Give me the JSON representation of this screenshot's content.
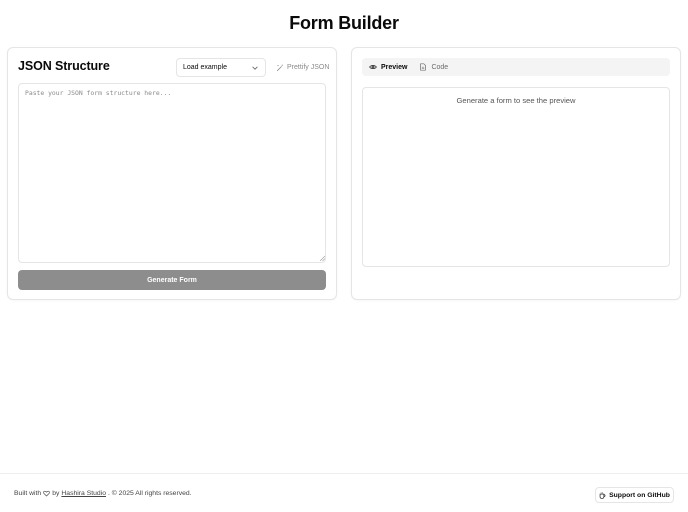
{
  "page": {
    "title": "Form Builder"
  },
  "editor": {
    "title": "JSON Structure",
    "example_select": {
      "value": "Load example",
      "icon": "chevron-down-icon"
    },
    "prettify_label": "Prettify JSON",
    "prettify_icon": "wand-icon",
    "textarea": {
      "value": "",
      "placeholder": "Paste your JSON form structure here..."
    },
    "generate_label": "Generate Form"
  },
  "preview": {
    "tabs": [
      {
        "label": "Preview",
        "icon": "eye-icon",
        "active": true
      },
      {
        "label": "Code",
        "icon": "file-icon",
        "active": false
      }
    ],
    "empty_message": "Generate a form to see the preview"
  },
  "footer": {
    "built_with": "Built with",
    "heart_icon": "heart-icon",
    "by": "by",
    "studio": "Hashira Studio",
    "rights": ". © 2025 All rights reserved.",
    "support_label": "Support on GitHub",
    "support_icon": "coffee-icon"
  },
  "colors": {
    "generate_button_bg": "#8d8d8d",
    "tabs_bg": "#f4f4f5",
    "border": "#e5e5e5"
  }
}
